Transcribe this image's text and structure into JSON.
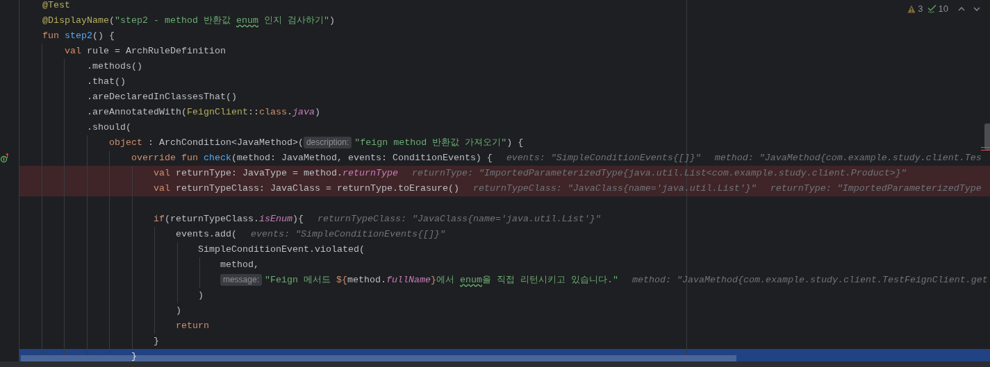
{
  "inspections": {
    "warnings": "3",
    "passed": "10"
  },
  "lines": [
    {
      "highlighted": false,
      "selected": false,
      "gutter_marker": false,
      "tokens": [
        {
          "kind": "ann",
          "text": "    @Test"
        }
      ]
    },
    {
      "highlighted": false,
      "selected": false,
      "gutter_marker": false,
      "tokens": [
        {
          "kind": "ann",
          "text": "    @DisplayName"
        },
        {
          "kind": "plain",
          "text": "("
        },
        {
          "kind": "str",
          "text": "\"step2 - method 반환값 "
        },
        {
          "kind": "typo",
          "text": "enum"
        },
        {
          "kind": "str",
          "text": " 인지 검사하기\""
        },
        {
          "kind": "plain",
          "text": ")"
        }
      ]
    },
    {
      "highlighted": false,
      "selected": false,
      "gutter_marker": false,
      "tokens": [
        {
          "kind": "kw",
          "text": "    fun "
        },
        {
          "kind": "fn",
          "text": "step2"
        },
        {
          "kind": "plain",
          "text": "() {"
        }
      ]
    },
    {
      "highlighted": false,
      "selected": false,
      "gutter_marker": false,
      "tokens": [
        {
          "kind": "kw",
          "text": "        val "
        },
        {
          "kind": "plain",
          "text": "rule = ArchRuleDefinition"
        }
      ]
    },
    {
      "highlighted": false,
      "selected": false,
      "gutter_marker": false,
      "tokens": [
        {
          "kind": "plain",
          "text": "            .methods()"
        }
      ]
    },
    {
      "highlighted": false,
      "selected": false,
      "gutter_marker": false,
      "tokens": [
        {
          "kind": "plain",
          "text": "            .that()"
        }
      ]
    },
    {
      "highlighted": false,
      "selected": false,
      "gutter_marker": false,
      "tokens": [
        {
          "kind": "plain",
          "text": "            .areDeclaredInClassesThat()"
        }
      ]
    },
    {
      "highlighted": false,
      "selected": false,
      "gutter_marker": false,
      "tokens": [
        {
          "kind": "plain",
          "text": "            .areAnnotatedWith("
        },
        {
          "kind": "ann",
          "text": "FeignClient"
        },
        {
          "kind": "plain",
          "text": "::"
        },
        {
          "kind": "kw",
          "text": "class"
        },
        {
          "kind": "plain",
          "text": "."
        },
        {
          "kind": "prop",
          "text": "java"
        },
        {
          "kind": "plain",
          "text": ")"
        }
      ]
    },
    {
      "highlighted": false,
      "selected": false,
      "gutter_marker": false,
      "tokens": [
        {
          "kind": "plain",
          "text": "            .should("
        }
      ]
    },
    {
      "highlighted": false,
      "selected": false,
      "gutter_marker": false,
      "tokens": [
        {
          "kind": "kw",
          "text": "                object "
        },
        {
          "kind": "plain",
          "text": ": ArchCondition<JavaMethod>("
        },
        {
          "kind": "param",
          "text": "description:"
        },
        {
          "kind": "str",
          "text": "\"feign method 반환값 가져오기\""
        },
        {
          "kind": "plain",
          "text": ") {"
        }
      ]
    },
    {
      "highlighted": false,
      "selected": false,
      "gutter_marker": true,
      "tokens": [
        {
          "kind": "kw",
          "text": "                    override fun "
        },
        {
          "kind": "fn",
          "text": "check"
        },
        {
          "kind": "plain",
          "text": "(method: JavaMethod, events: ConditionEvents) {"
        },
        {
          "kind": "hint",
          "text": "events: \"SimpleConditionEvents{[]}\""
        },
        {
          "kind": "hint",
          "text": "method: \"JavaMethod{com.example.study.client.Tes"
        }
      ]
    },
    {
      "highlighted": true,
      "selected": false,
      "gutter_marker": false,
      "tokens": [
        {
          "kind": "kw",
          "text": "                        val "
        },
        {
          "kind": "plain",
          "text": "returnType: JavaType = method."
        },
        {
          "kind": "prop",
          "text": "returnType"
        },
        {
          "kind": "hint",
          "text": "returnType: \"ImportedParameterizedType{java.util.List<com.example.study.client.Product>}\""
        }
      ]
    },
    {
      "highlighted": true,
      "selected": false,
      "gutter_marker": false,
      "tokens": [
        {
          "kind": "kw",
          "text": "                        val "
        },
        {
          "kind": "plain",
          "text": "returnTypeClass: JavaClass = returnType.toErasure()"
        },
        {
          "kind": "hint",
          "text": "returnTypeClass: \"JavaClass{name='java.util.List'}\""
        },
        {
          "kind": "hint",
          "text": "returnType: \"ImportedParameterizedType"
        }
      ]
    },
    {
      "highlighted": false,
      "selected": false,
      "gutter_marker": false
    },
    {
      "highlighted": false,
      "selected": false,
      "gutter_marker": false,
      "tokens": [
        {
          "kind": "kw",
          "text": "                        if"
        },
        {
          "kind": "plain",
          "text": "(returnTypeClass."
        },
        {
          "kind": "prop",
          "text": "isEnum"
        },
        {
          "kind": "plain",
          "text": "){"
        },
        {
          "kind": "hint",
          "text": "returnTypeClass: \"JavaClass{name='java.util.List'}\""
        }
      ]
    },
    {
      "highlighted": false,
      "selected": false,
      "gutter_marker": false,
      "tokens": [
        {
          "kind": "plain",
          "text": "                            events.add("
        },
        {
          "kind": "hint",
          "text": "events: \"SimpleConditionEvents{[]}\""
        }
      ]
    },
    {
      "highlighted": false,
      "selected": false,
      "gutter_marker": false,
      "tokens": [
        {
          "kind": "plain",
          "text": "                                SimpleConditionEvent.violated("
        }
      ]
    },
    {
      "highlighted": false,
      "selected": false,
      "gutter_marker": false,
      "tokens": [
        {
          "kind": "plain",
          "text": "                                    method,"
        }
      ]
    },
    {
      "highlighted": false,
      "selected": false,
      "gutter_marker": false,
      "tokens": [
        {
          "kind": "param",
          "text": "                                    message:"
        },
        {
          "kind": "str",
          "text": "\"Feign 메서드 "
        },
        {
          "kind": "kw",
          "text": "${"
        },
        {
          "kind": "plain",
          "text": "method."
        },
        {
          "kind": "prop",
          "text": "fullName"
        },
        {
          "kind": "kw",
          "text": "}"
        },
        {
          "kind": "str",
          "text": "에서 "
        },
        {
          "kind": "typo",
          "text": "enum"
        },
        {
          "kind": "str",
          "text": "을 직접 리턴시키고 있습니다.\""
        },
        {
          "kind": "hint",
          "text": "method: \"JavaMethod{com.example.study.client.TestFeignClient.get"
        }
      ]
    },
    {
      "highlighted": false,
      "selected": false,
      "gutter_marker": false,
      "tokens": [
        {
          "kind": "plain",
          "text": "                                )"
        }
      ]
    },
    {
      "highlighted": false,
      "selected": false,
      "gutter_marker": false,
      "tokens": [
        {
          "kind": "plain",
          "text": "                            )"
        }
      ]
    },
    {
      "highlighted": false,
      "selected": false,
      "gutter_marker": false,
      "tokens": [
        {
          "kind": "kw",
          "text": "                            return"
        }
      ]
    },
    {
      "highlighted": false,
      "selected": false,
      "gutter_marker": false,
      "tokens": [
        {
          "kind": "plain",
          "text": "                        }"
        }
      ]
    },
    {
      "highlighted": false,
      "selected": true,
      "gutter_marker": false,
      "tokens": [
        {
          "kind": "plain",
          "text": "                    }"
        }
      ]
    }
  ]
}
